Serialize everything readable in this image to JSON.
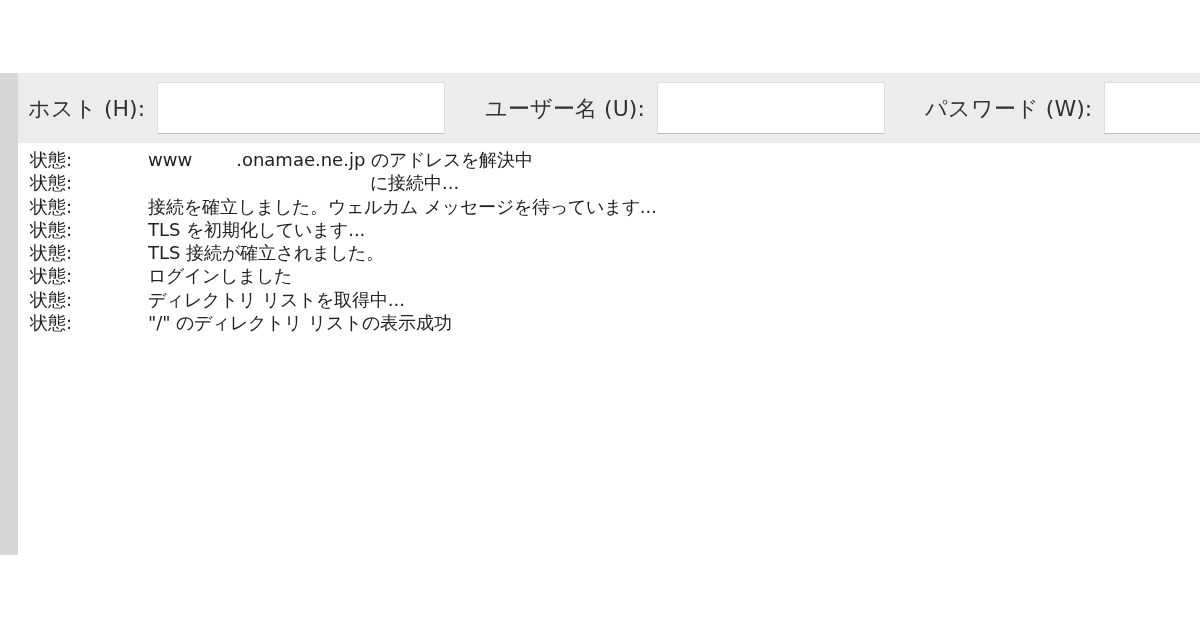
{
  "toolbar": {
    "fields": [
      {
        "label": "ホスト (H):"
      },
      {
        "label": "ユーザー名 (U):"
      },
      {
        "label": "パスワード (W):"
      }
    ]
  },
  "log": [
    {
      "label": "状態:",
      "parts": [
        "www",
        ".onamae.ne.jp のアドレスを解決中"
      ],
      "redacted_prefix": false
    },
    {
      "label": "状態:",
      "parts": [
        "に接続中..."
      ],
      "redacted_prefix": true
    },
    {
      "label": "状態:",
      "parts": [
        "接続を確立しました。ウェルカム メッセージを待っています..."
      ],
      "redacted_prefix": false
    },
    {
      "label": "状態:",
      "parts": [
        "TLS を初期化しています..."
      ],
      "redacted_prefix": false
    },
    {
      "label": "状態:",
      "parts": [
        "TLS 接続が確立されました。"
      ],
      "redacted_prefix": false
    },
    {
      "label": "状態:",
      "parts": [
        "ログインしました"
      ],
      "redacted_prefix": false
    },
    {
      "label": "状態:",
      "parts": [
        "ディレクトリ リストを取得中..."
      ],
      "redacted_prefix": false
    },
    {
      "label": "状態:",
      "parts": [
        "\"/\" のディレクトリ リストの表示成功"
      ],
      "redacted_prefix": false
    }
  ]
}
